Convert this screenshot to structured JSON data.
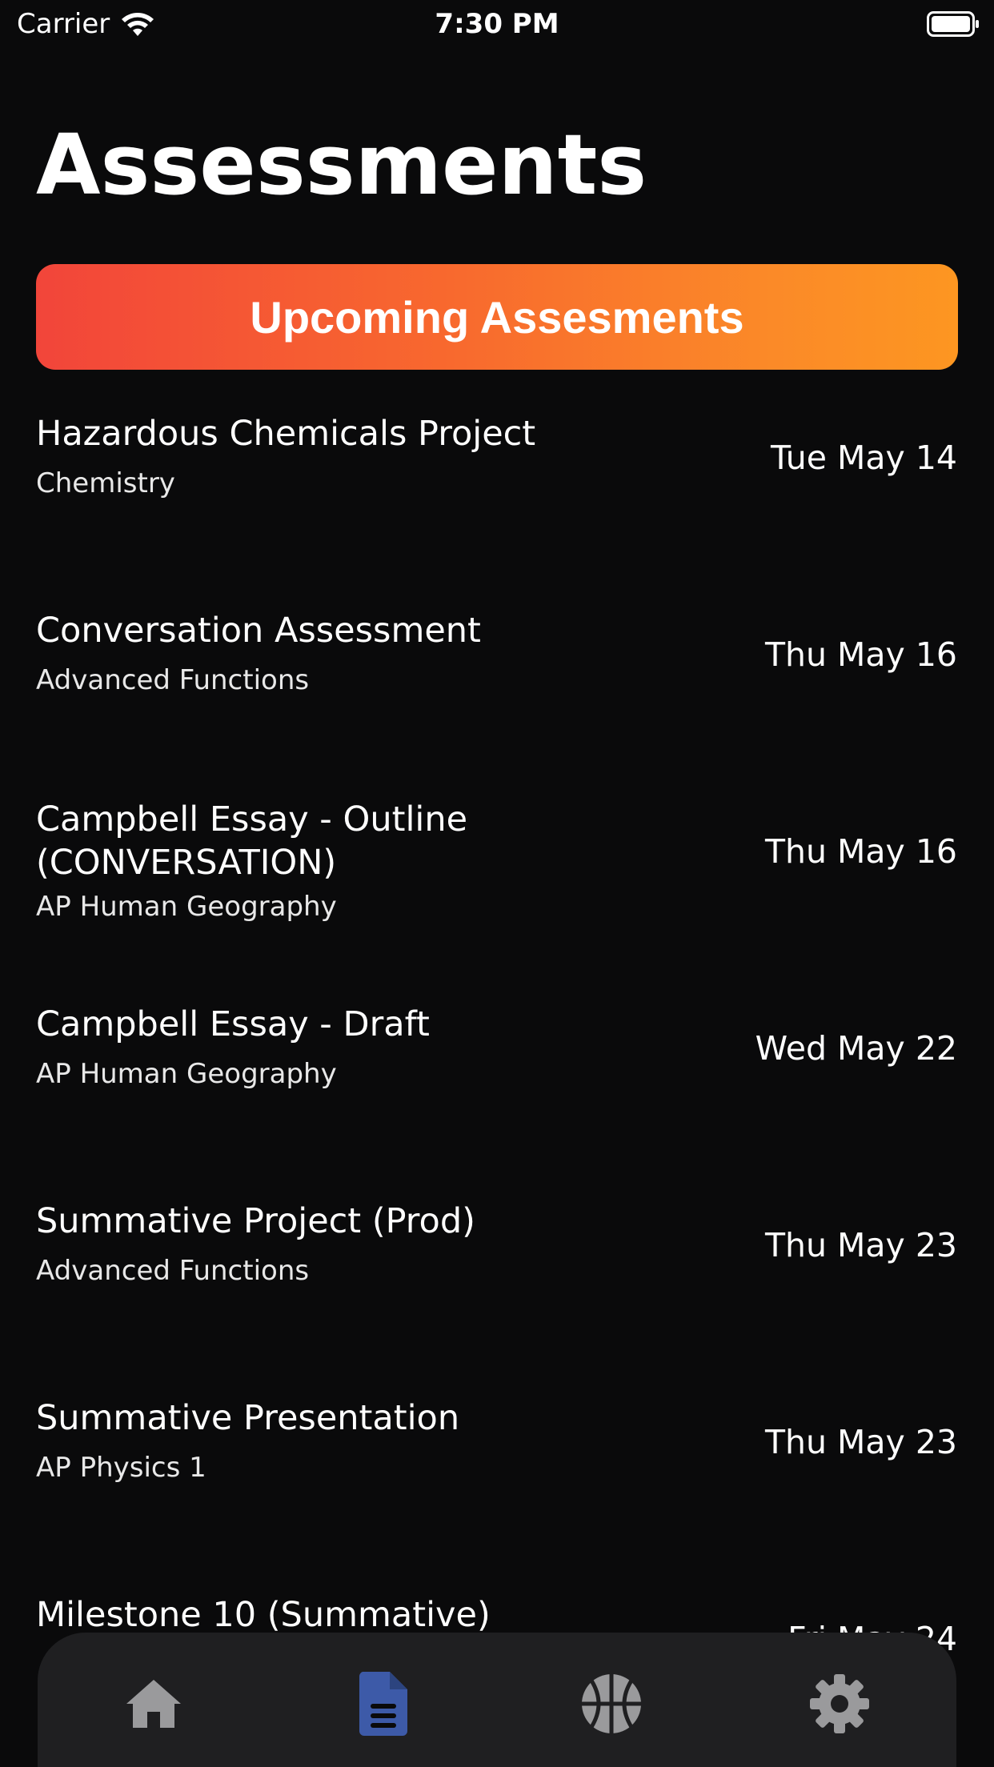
{
  "status_bar": {
    "carrier": "Carrier",
    "time": "7:30 PM",
    "wifi_icon": "wifi-icon",
    "battery_icon": "battery-icon"
  },
  "page": {
    "title": "Assessments"
  },
  "banner": {
    "label": "Upcoming Assesments",
    "gradient_start": "#f2453a",
    "gradient_end": "#fd9621"
  },
  "assessments": [
    {
      "title": "Hazardous Chemicals Project",
      "course": "Chemistry",
      "date": "Tue May 14"
    },
    {
      "title": "Conversation Assessment",
      "course": "Advanced Functions",
      "date": "Thu May 16"
    },
    {
      "title": "Campbell Essay - Outline (CONVERSATION)",
      "course": "AP Human Geography",
      "date": "Thu May 16"
    },
    {
      "title": "Campbell Essay - Draft",
      "course": "AP Human Geography",
      "date": "Wed May 22"
    },
    {
      "title": "Summative Project (Prod)",
      "course": "Advanced Functions",
      "date": "Thu May 23"
    },
    {
      "title": "Summative Presentation",
      "course": "AP Physics 1",
      "date": "Thu May 23"
    },
    {
      "title": "Milestone 10 (Summative)",
      "course": "",
      "date": "Fri May 24"
    }
  ],
  "tab_bar": {
    "tabs": [
      {
        "icon": "home-icon",
        "active": false
      },
      {
        "icon": "document-icon",
        "active": true
      },
      {
        "icon": "basketball-icon",
        "active": false
      },
      {
        "icon": "gear-icon",
        "active": false
      }
    ],
    "active_color": "#3d5aa8",
    "inactive_color": "#9a9a9c"
  }
}
